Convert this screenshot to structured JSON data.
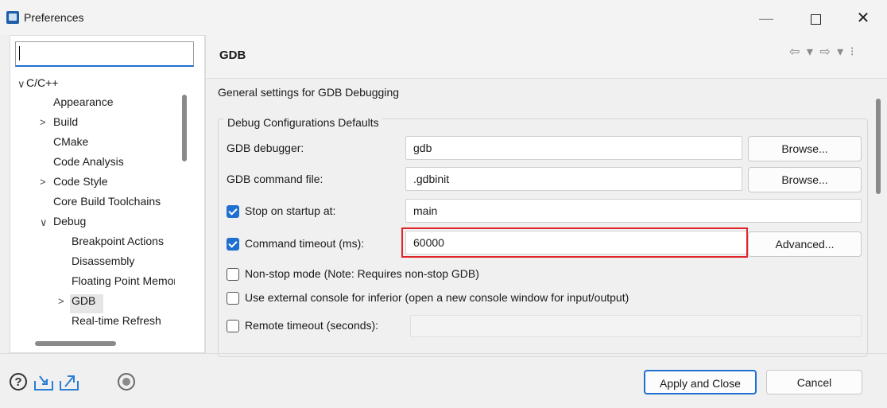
{
  "window": {
    "title": "Preferences",
    "min_glyph": "—",
    "close_glyph": "✕"
  },
  "filter": {
    "value": ""
  },
  "tree": [
    {
      "label": "C/C++",
      "expander": "∨"
    },
    {
      "label": "Appearance",
      "expander": ""
    },
    {
      "label": "Build",
      "expander": ">"
    },
    {
      "label": "CMake",
      "expander": ""
    },
    {
      "label": "Code Analysis",
      "expander": ""
    },
    {
      "label": "Code Style",
      "expander": ">"
    },
    {
      "label": "Core Build Toolchains",
      "expander": ""
    },
    {
      "label": "Debug",
      "expander": "∨"
    },
    {
      "label": "Breakpoint Actions",
      "expander": ""
    },
    {
      "label": "Disassembly",
      "expander": ""
    },
    {
      "label": "Floating Point Memory",
      "expander": ""
    },
    {
      "label": "GDB",
      "expander": ">"
    },
    {
      "label": "Real-time Refresh",
      "expander": ""
    }
  ],
  "page": {
    "title": "GDB",
    "description": "General settings for GDB Debugging",
    "group_title": "Debug Configurations Defaults",
    "gdb_debugger": {
      "label": "GDB debugger:",
      "value": "gdb",
      "button": "Browse..."
    },
    "gdb_command_file": {
      "label": "GDB command file:",
      "value": ".gdbinit",
      "button": "Browse..."
    },
    "stop_on_startup": {
      "label": "Stop on startup at:",
      "checked": true,
      "value": "main"
    },
    "command_timeout": {
      "label": "Command timeout (ms):",
      "checked": true,
      "value": "60000",
      "button": "Advanced..."
    },
    "non_stop": {
      "label": "Non-stop mode (Note: Requires non-stop GDB)",
      "checked": false
    },
    "external_console": {
      "label": "Use external console for inferior (open a new console window for input/output)",
      "checked": false
    },
    "remote_timeout": {
      "label": "Remote timeout (seconds):",
      "checked": false,
      "value": ""
    }
  },
  "nav": {
    "icons": "⇦ ▾ ⇨ ▾ ⁝"
  },
  "footer": {
    "help_glyph": "?",
    "apply_label": "Apply and Close",
    "cancel_label": "Cancel"
  },
  "colors": {
    "accent": "#1f6fd0",
    "highlight": "#e0262a"
  }
}
